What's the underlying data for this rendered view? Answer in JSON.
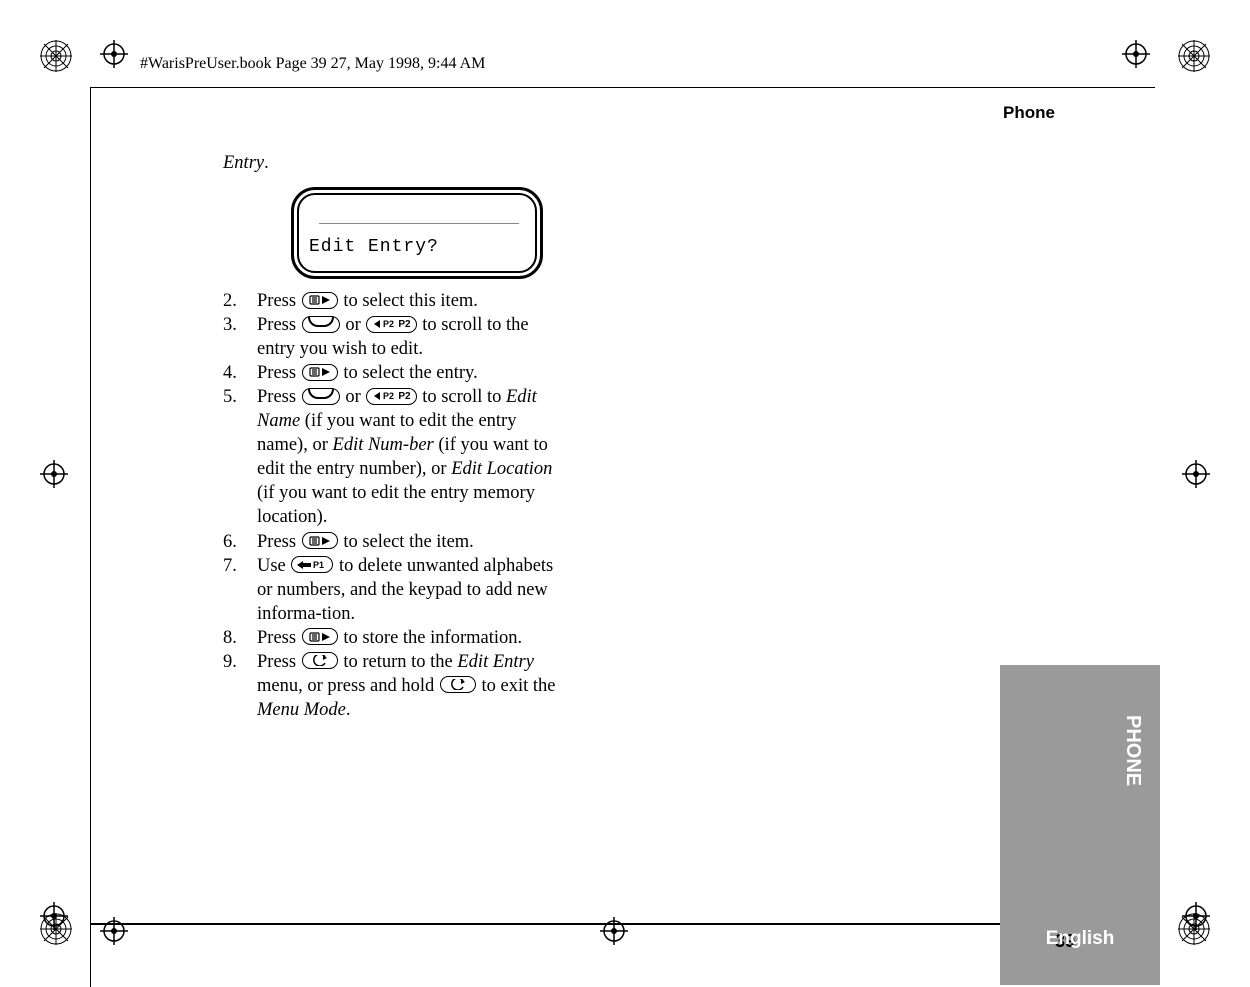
{
  "header": {
    "file_info": "#WarisPreUser.book  Page 39  27, May 1998,   9:44 AM",
    "running_head": "Phone"
  },
  "entry_lead": "Entry",
  "lcd": {
    "text": "Edit Entry?"
  },
  "steps": [
    {
      "n": "2.",
      "pre": "Press ",
      "btns": [
        "menu"
      ],
      "post": " to select this item."
    },
    {
      "n": "3.",
      "pre": "Press ",
      "btns": [
        "arc"
      ],
      "mid": " or ",
      "btns2": [
        "p2"
      ],
      "post": " to scroll to the entry you wish to edit."
    },
    {
      "n": "4.",
      "pre": "Press ",
      "btns": [
        "menu"
      ],
      "post": " to select the entry."
    },
    {
      "n": "5.",
      "pre": "Press ",
      "btns": [
        "arc"
      ],
      "mid": " or ",
      "btns2": [
        "p2"
      ],
      "post_segments": [
        {
          "t": " to scroll to "
        },
        {
          "t": "Edit Name",
          "i": true
        },
        {
          "t": " (if you want to edit the entry name), or "
        },
        {
          "t": "Edit Num-ber",
          "i": true,
          "break_after_hyphen": true
        },
        {
          "t": " (if you want to edit the entry number), or "
        },
        {
          "t": "Edit Location",
          "i": true
        },
        {
          "t": " (if you want to edit the entry memory location)."
        }
      ]
    },
    {
      "n": "6.",
      "pre": "Press ",
      "btns": [
        "menu"
      ],
      "post": " to select the item."
    },
    {
      "n": "7.",
      "pre": "Use ",
      "btns": [
        "p1del"
      ],
      "post": " to delete unwanted alphabets or numbers, and the keypad to add new informa-tion.",
      "soft_hyphen_at": "informa-"
    },
    {
      "n": "8.",
      "pre": "Press ",
      "btns": [
        "menu"
      ],
      "post": " to store the information."
    },
    {
      "n": "9.",
      "pre": "Press ",
      "btns": [
        "back"
      ],
      "mid": " to return to the ",
      "italic_mid": "Edit Entry",
      "post_mid": " menu, or press and hold ",
      "btns2": [
        "back"
      ],
      "post_segments": [
        {
          "t": " to exit the "
        },
        {
          "t": "Menu Mode",
          "i": true
        },
        {
          "t": "."
        }
      ]
    }
  ],
  "side_tab": "PHONE",
  "footer": {
    "page": "39",
    "language": "English"
  },
  "icons": {
    "menu": "menu-select-icon",
    "arc": "scroll-up-icon",
    "p2": "p2-key-icon",
    "p1del": "p1-delete-key-icon",
    "back": "back-key-icon"
  }
}
